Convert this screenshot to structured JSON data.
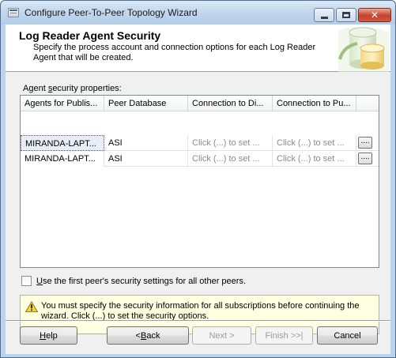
{
  "window": {
    "title": "Configure Peer-To-Peer Topology Wizard"
  },
  "header": {
    "title": "Log Reader Agent Security",
    "description": "Specify the process account and connection options for each Log Reader Agent that will be created."
  },
  "section_label": {
    "prefix": "Agent ",
    "accel": "s",
    "rest": "ecurity properties:"
  },
  "grid": {
    "columns": [
      "Agents for Publis...",
      "Peer Database",
      "Connection to Di...",
      "Connection to Pu..."
    ],
    "rows": [
      {
        "agent": "MIRANDA-LAPT...",
        "db": "ASI",
        "dist": "Click (...) to set ...",
        "pub": "Click (...) to set ...",
        "button": "...."
      },
      {
        "agent": "MIRANDA-LAPT...",
        "db": "ASI",
        "dist": "Click (...) to set ...",
        "pub": "Click (...) to set ...",
        "button": "...."
      }
    ]
  },
  "checkbox": {
    "accel": "U",
    "rest": "se the first peer's security settings for all other peers.",
    "checked": false
  },
  "warning": {
    "text": "You must specify the security information for all subscriptions before continuing the wizard. Click (...) to set the security options."
  },
  "buttons": {
    "help": {
      "accel": "H",
      "rest": "elp"
    },
    "back": {
      "prefix": "< ",
      "accel": "B",
      "rest": "ack"
    },
    "next": "Next >",
    "finish": "Finish >>|",
    "cancel": "Cancel"
  },
  "colors": {
    "warning_bg": "#ffffe1",
    "title_bar": "#c1d6ee",
    "close": "#c7412b"
  }
}
